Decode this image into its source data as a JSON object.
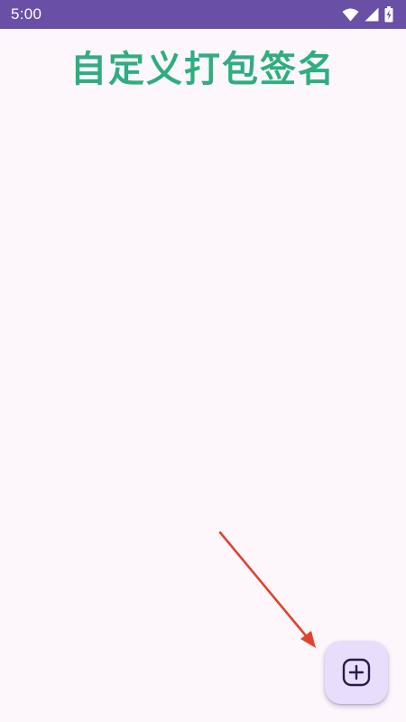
{
  "status_bar": {
    "time": "5:00",
    "icons": [
      "wifi-icon",
      "cellular-signal-icon",
      "battery-charging-icon"
    ]
  },
  "page": {
    "title": "自定义打包签名"
  },
  "fab": {
    "icon": "add-box-icon"
  },
  "annotation": {
    "icon": "red-arrow-icon",
    "color": "#e0432c"
  },
  "colors": {
    "status_bar": "#6a4fa6",
    "title": "#2eae7f",
    "background": "#fdf7fc",
    "fab_background": "#e8ddfa",
    "fab_icon": "#2a1a4a"
  }
}
